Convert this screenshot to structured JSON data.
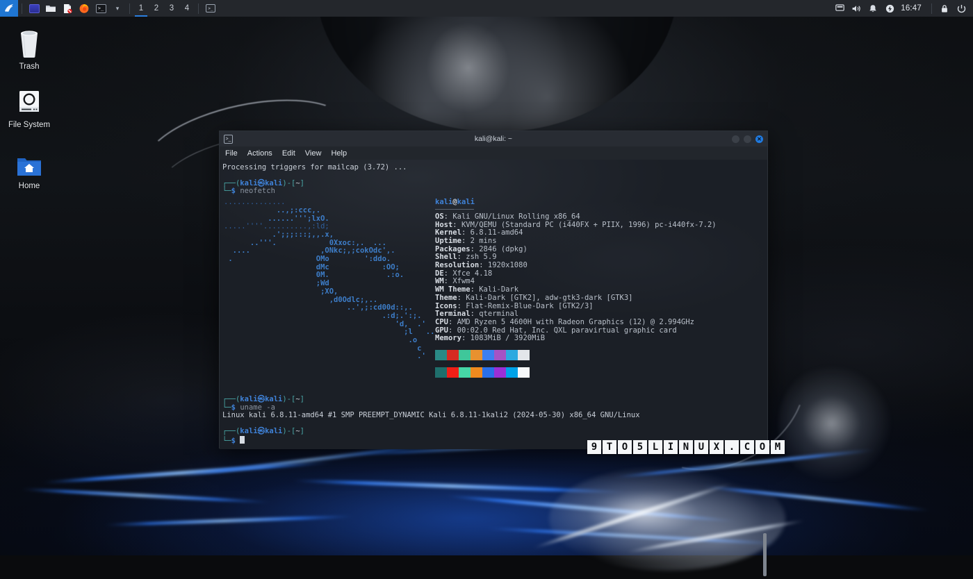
{
  "panel": {
    "menu_icon": "kali-dragon-menu-icon",
    "launchers": [
      {
        "name": "terminal-emulator-launcher",
        "icon": "terminal-icon"
      },
      {
        "name": "file-manager-launcher",
        "icon": "folder-icon"
      },
      {
        "name": "text-editor-launcher",
        "icon": "document-icon"
      },
      {
        "name": "web-browser-launcher",
        "icon": "firefox-icon"
      },
      {
        "name": "root-terminal-launcher",
        "icon": "terminal-prompt-icon"
      }
    ],
    "dropdown_glyph": "▾",
    "workspaces": [
      "1",
      "2",
      "3",
      "4"
    ],
    "active_workspace": "1",
    "window_button_icon": "window-icon",
    "tray": [
      {
        "name": "display-settings-icon",
        "glyph": "▣"
      },
      {
        "name": "volume-icon",
        "glyph": "🔊"
      },
      {
        "name": "notifications-icon",
        "glyph": "🔔"
      },
      {
        "name": "power-manager-icon",
        "glyph": "⚡"
      }
    ],
    "clock": "16:47",
    "tray_right": [
      {
        "name": "lock-screen-icon",
        "glyph": "🔒"
      },
      {
        "name": "log-out-icon",
        "glyph": "⏻"
      }
    ]
  },
  "desktop_icons": [
    {
      "label": "Trash",
      "icon": "trash-icon"
    },
    {
      "label": "File System",
      "icon": "drive-icon"
    },
    {
      "label": "Home",
      "icon": "home-folder-icon"
    }
  ],
  "terminal": {
    "title": "kali@kali: ~",
    "titlebar_icon": "terminal-icon",
    "window_buttons": {
      "minimize": "–",
      "maximize": "□",
      "close": "✕"
    },
    "menu": [
      "File",
      "Actions",
      "Edit",
      "View",
      "Help"
    ],
    "scrollback_line": "Processing triggers for mailcap (3.72) ...",
    "prompt": {
      "open": "┌──(",
      "user": "kali",
      "at": "㉿",
      "host": "kali",
      "close": ")-[",
      "path": "~",
      "bracket_end": "]",
      "second_line": "└─$"
    },
    "command_1": "neofetch",
    "command_2": "uname -a",
    "uname_output": "Linux kali 6.8.11-amd64 #1 SMP PREEMPT_DYNAMIC Kali 6.8.11-1kali2 (2024-05-30) x86_64 GNU/Linux",
    "neofetch": {
      "user_host": {
        "user": "kali",
        "sep": "@",
        "host": "kali"
      },
      "fields": [
        {
          "key": "OS",
          "value": "Kali GNU/Linux Rolling x86_64"
        },
        {
          "key": "Host",
          "value": "KVM/QEMU (Standard PC (i440FX + PIIX, 1996) pc-i440fx-7.2)"
        },
        {
          "key": "Kernel",
          "value": "6.8.11-amd64"
        },
        {
          "key": "Uptime",
          "value": "2 mins"
        },
        {
          "key": "Packages",
          "value": "2846 (dpkg)"
        },
        {
          "key": "Shell",
          "value": "zsh 5.9"
        },
        {
          "key": "Resolution",
          "value": "1920x1080"
        },
        {
          "key": "DE",
          "value": "Xfce 4.18"
        },
        {
          "key": "WM",
          "value": "Xfwm4"
        },
        {
          "key": "WM Theme",
          "value": "Kali-Dark"
        },
        {
          "key": "Theme",
          "value": "Kali-Dark [GTK2], adw-gtk3-dark [GTK3]"
        },
        {
          "key": "Icons",
          "value": "Flat-Remix-Blue-Dark [GTK2/3]"
        },
        {
          "key": "Terminal",
          "value": "qterminal"
        },
        {
          "key": "CPU",
          "value": "AMD Ryzen 5 4600H with Radeon Graphics (12) @ 2.994GHz"
        },
        {
          "key": "GPU",
          "value": "00:02.0 Red Hat, Inc. QXL paravirtual graphic card"
        },
        {
          "key": "Memory",
          "value": "1083MiB / 3920MiB"
        }
      ],
      "palette_row1": [
        "#2a8a86",
        "#d52b22",
        "#3fc79a",
        "#e8912f",
        "#3d7ff0",
        "#a553c4",
        "#2ca9e0",
        "#e3e6ea"
      ],
      "palette_row2": [
        "#1f6f6c",
        "#ef1f17",
        "#46d7a6",
        "#f08a1e",
        "#2a6fe8",
        "#9b2fd6",
        "#00a2e8",
        "#f6f8fa"
      ],
      "ascii_art": [
        "..............",
        "            ..,;:ccc,.",
        "          ......''';lxO.",
        ".....''''..........,:ld;",
        "           .';;;:::;,,.x,",
        "      ..'''.            0Xxoc:,.  ...",
        "  ....                ,ONkc;,;cokOdc',.",
        " .                   OMo        ':ddo.",
        "                     dMc            :OO;",
        "                     0M.             .:o.",
        "                     ;Wd",
        "                      ;XO,",
        "                        ,d0Odlc;,..",
        "                            ..',;:cd00d::,.",
        "                                    .:d;.':;.",
        "                                       'd,  .'",
        "                                         ;l   ..",
        "                                          .o",
        "                                            c",
        "                                            .'"
      ]
    },
    "scrollbar": "vertical-scrollbar"
  },
  "watermark": {
    "text": "9TO5LINUX.COM",
    "chars": [
      "9",
      "T",
      "O",
      "5",
      "L",
      "I",
      "N",
      "U",
      "X",
      ".",
      "C",
      "O",
      "M"
    ]
  },
  "colors": {
    "panel_bg": "#24272c",
    "terminal_bg": "#1b1f26",
    "accent_blue": "#1f7ae0",
    "prompt_blue": "#4a8fe0",
    "prompt_cyan": "#4aa8a8",
    "wallpaper_glow": "#2f7dff"
  }
}
